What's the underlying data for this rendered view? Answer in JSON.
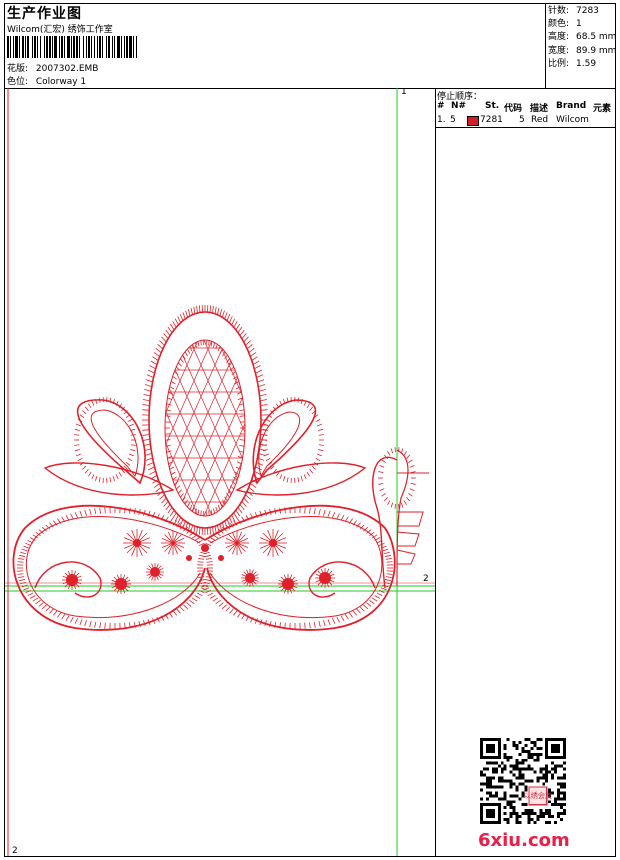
{
  "header": {
    "title": "生产作业图",
    "subtitle": "Wilcom(汇宏) 绣饰工作室",
    "design_label": "花版:",
    "design_value": "2007302.EMB",
    "colorway_label": "色位:",
    "colorway_value": "Colorway 1"
  },
  "stats": {
    "stitches_label": "针数:",
    "stitches_value": "7283",
    "colors_label": "颜色:",
    "colors_value": "1",
    "height_label": "高度:",
    "height_value": "68.5 mm",
    "width_label": "宽度:",
    "width_value": "89.9 mm",
    "scale_label": "比例:",
    "scale_value": "1.59"
  },
  "canvas": {
    "guide_top_label": "1",
    "guide_right_label": "2",
    "guide_bottom_label": "2",
    "thread_color": "#e0202a",
    "guide_color": "#22cc22"
  },
  "stop_sequence": {
    "heading": "停止顺序：",
    "columns": [
      "#",
      "N#",
      "St.",
      "代码",
      "描述",
      "Brand",
      "元素"
    ],
    "rows": [
      {
        "index": "1.",
        "needle": "5",
        "swatch_color": "#d01f26",
        "stitches": "7281",
        "code": "5",
        "description": "Red",
        "brand": "Wilcom"
      }
    ]
  },
  "watermark": {
    "text": "6xiu.com",
    "stamp_text": "以绣会友"
  }
}
